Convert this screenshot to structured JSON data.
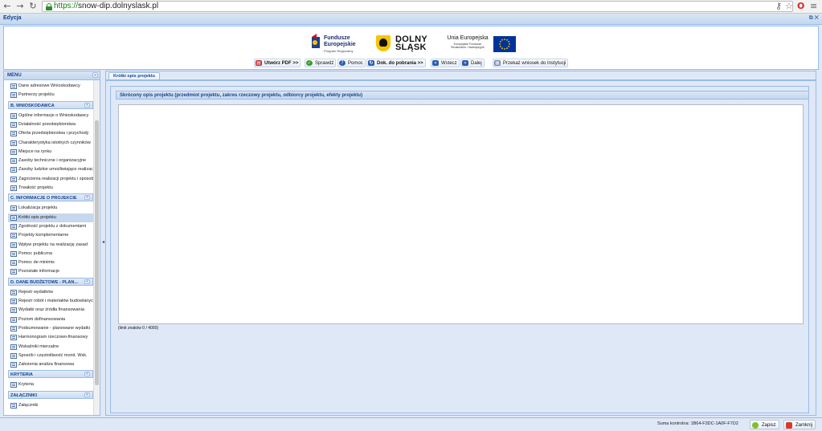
{
  "browser": {
    "url_scheme": "https://",
    "url_host": "snow-dip.dolnyslask.pl",
    "back_icon": "back-arrow-icon",
    "forward_icon": "forward-arrow-icon",
    "reload_icon": "reload-icon"
  },
  "app": {
    "title": "Edycja"
  },
  "logos": {
    "fundusze_line1": "Fundusze",
    "fundusze_line2": "Europejskie",
    "fundusze_sub": "Program Regionalny",
    "dolny_line1": "DOLNY",
    "dolny_line2": "ŚLĄSK",
    "unia": "Unia Europejska",
    "unia_sub1": "Europejskie Fundusze",
    "unia_sub2": "Strukturalne i Inwestycyjne"
  },
  "toolbar": {
    "pdf": "Utwórz PDF >>",
    "check": "Sprawdź",
    "help": "Pomoc",
    "docs": "Dok. do pobrania >>",
    "back": "Wstecz",
    "next": "Dalej",
    "submit": "Przekaż wniosek do Instytucji"
  },
  "sidebar": {
    "title": "MENU",
    "top_items": [
      "Dane adresowe Wnioskodawcy",
      "Partnerzy projektu"
    ],
    "sections": [
      {
        "title": "B. WNIOSKODAWCA",
        "items": [
          "Ogólne informacje o Wnioskodawcy",
          "Działalność przedsiębiorstwa",
          "Oferta przedsiębiorstwa i przychody",
          "Charakterystyka istotnych czynników",
          "Miejsce na rynku",
          "Zasoby techniczne i organizacyjne",
          "Zasoby ludzkie umożliwiające realizację",
          "Zagrożenia realizacji projektu i sposoby",
          "Trwałość projektu"
        ]
      },
      {
        "title": "C. INFORMACJE O PROJEKCIE",
        "items": [
          "Lokalizacja projektu",
          "Krótki opis projektu",
          "Zgodność projektu z dokumentami",
          "Projekty komplementarne",
          "Wpływ projektu na realizację zasad",
          "Pomoc publiczna",
          "Pomoc de minimis",
          "Pozostałe informacje"
        ]
      },
      {
        "title": "D. DANE BUDŻETOWE - PLAN...",
        "items": [
          "Rejestr wydatków",
          "Rejestr robót i materiałów budowlanych",
          "Wydatki oraz źródła finansowania",
          "Poziom dofinansowania",
          "Podsumowanie - planowane wydatki",
          "Harmonogram rzeczowo-finansowy",
          "Wskaźniki mierzalne",
          "Sposób i częstotliwość monit. Wsk.",
          "Założenia analiza finansowa"
        ]
      },
      {
        "title": "KRYTERIA",
        "items": [
          "Kryteria"
        ]
      },
      {
        "title": "ZAŁĄCZNIKI",
        "items": [
          "Załączniki"
        ]
      }
    ]
  },
  "main": {
    "tab": "Krótki opis projektu",
    "field_label": "Skrócony opis projektu (przedmiot projektu, zakres rzeczowy projektu, odbiorcy projektu, efekty projektu)",
    "field_value": "",
    "limit": "(limit znaków 0 / 4000)"
  },
  "status": {
    "checksum": "Suma kontrolna: 1B64-F3DC-1A0F-F7D2",
    "save": "Zapisz",
    "close": "Zamknij"
  }
}
